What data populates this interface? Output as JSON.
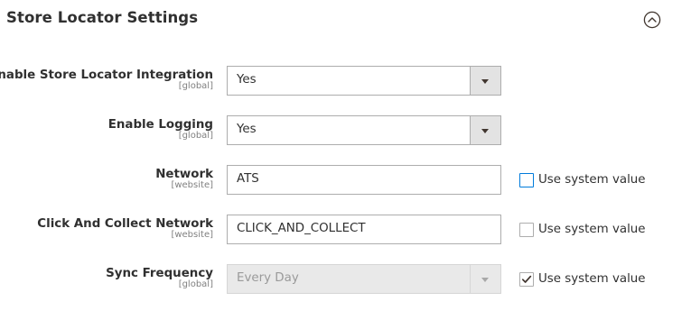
{
  "section": {
    "title": "Store Locator Settings",
    "toggle_icon": "chevron-up-circle-icon"
  },
  "fields": [
    {
      "label": "Enable Store Locator Integration",
      "scope": "[global]",
      "type": "select",
      "value": "Yes",
      "disabled": false
    },
    {
      "label": "Enable Logging",
      "scope": "[global]",
      "type": "select",
      "value": "Yes",
      "disabled": false
    },
    {
      "label": "Network",
      "scope": "[website]",
      "type": "text",
      "value": "ATS",
      "use_system_value": {
        "label": "Use system value",
        "checked": false,
        "focused": true
      }
    },
    {
      "label": "Click And Collect Network",
      "scope": "[website]",
      "type": "text",
      "value": "CLICK_AND_COLLECT",
      "use_system_value": {
        "label": "Use system value",
        "checked": false,
        "focused": false
      }
    },
    {
      "label": "Sync Frequency",
      "scope": "[global]",
      "type": "select",
      "value": "Every Day",
      "disabled": true,
      "use_system_value": {
        "label": "Use system value",
        "checked": true,
        "focused": false
      }
    }
  ],
  "colors": {
    "text": "#303030",
    "scope": "#808080",
    "border": "#adadad",
    "focus": "#007bdb",
    "disabled_bg": "#e9e9e9"
  }
}
